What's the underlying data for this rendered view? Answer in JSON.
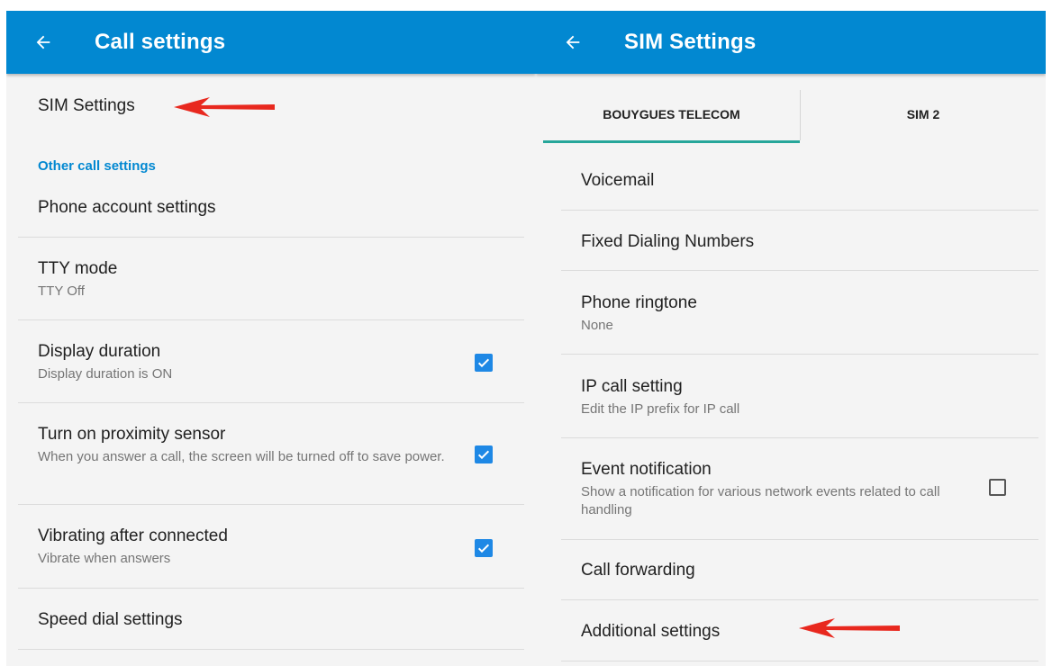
{
  "left": {
    "title": "Call settings",
    "sim_settings": "SIM Settings",
    "section_header": "Other call settings",
    "items": [
      {
        "title": "Phone account settings"
      },
      {
        "title": "TTY mode",
        "subtitle": "TTY Off"
      },
      {
        "title": "Display duration",
        "subtitle": "Display duration is ON",
        "checked": true
      },
      {
        "title": "Turn on proximity sensor",
        "subtitle": "When you answer a call, the screen will be turned off to save power.",
        "checked": true
      },
      {
        "title": "Vibrating after connected",
        "subtitle": "Vibrate when answers",
        "checked": true
      },
      {
        "title": "Speed dial settings"
      }
    ]
  },
  "right": {
    "title": "SIM Settings",
    "tabs": [
      {
        "label": "BOUYGUES TELECOM",
        "selected": true
      },
      {
        "label": "SIM 2",
        "selected": false
      }
    ],
    "items": [
      {
        "title": "Voicemail"
      },
      {
        "title": "Fixed Dialing Numbers"
      },
      {
        "title": "Phone ringtone",
        "subtitle": "None"
      },
      {
        "title": "IP call setting",
        "subtitle": "Edit the IP prefix for IP call"
      },
      {
        "title": "Event notification",
        "subtitle": "Show a notification for various network events related to call handling",
        "checked": false
      },
      {
        "title": "Call forwarding"
      },
      {
        "title": "Additional settings"
      }
    ]
  },
  "colors": {
    "appbar": "#0288d1",
    "accent": "#0288d1",
    "checkbox": "#1e88e5",
    "tab_indicator": "#26a69a",
    "annotation_arrow": "#e8281e"
  }
}
